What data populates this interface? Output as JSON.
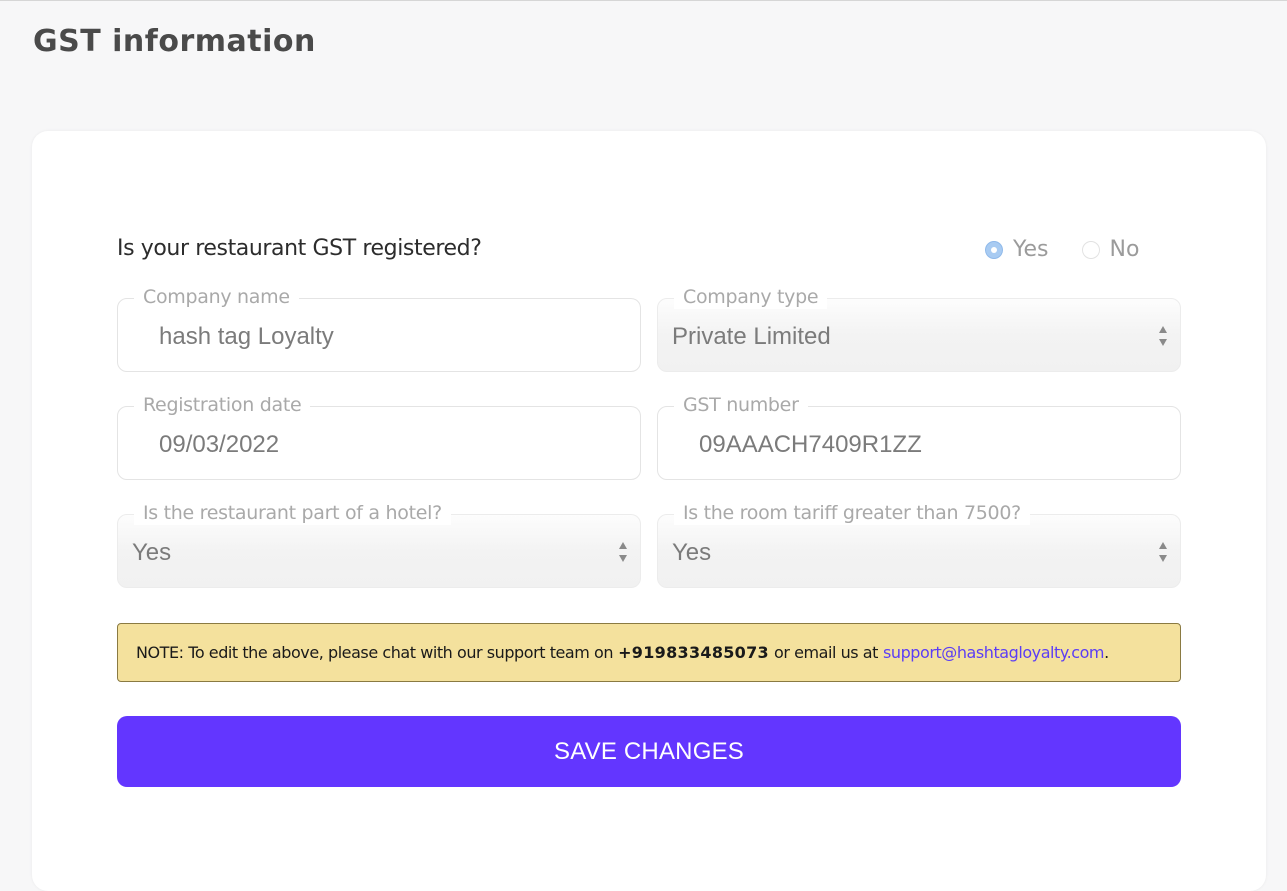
{
  "page": {
    "title": "GST information"
  },
  "form": {
    "question": "Is your restaurant GST registered?",
    "radio": {
      "yes_label": "Yes",
      "no_label": "No",
      "selected": "Yes"
    },
    "fields": {
      "company_name": {
        "label": "Company name",
        "value": "hash tag Loyalty"
      },
      "company_type": {
        "label": "Company type",
        "value": "Private Limited"
      },
      "registration_date": {
        "label": "Registration date",
        "value": "09/03/2022"
      },
      "gst_number": {
        "label": "GST number",
        "value": "09AAACH7409R1ZZ"
      },
      "part_of_hotel": {
        "label": "Is the restaurant part of a hotel?",
        "value": "Yes"
      },
      "room_tariff": {
        "label": "Is the room tariff greater than 7500?",
        "value": "Yes"
      }
    }
  },
  "note": {
    "text_before": "NOTE: To edit the above, please chat with our support team on",
    "phone": "+919833485073",
    "text_middle": "or email us at",
    "email": "support@hashtagloyalty.com",
    "text_after": "."
  },
  "actions": {
    "save_label": "SAVE CHANGES"
  },
  "colors": {
    "accent": "#6336ff",
    "note_background": "#f4e19d",
    "link": "#5b3df5",
    "radio_selected": "#a8cbf2"
  },
  "icons": {
    "select_arrows": "updown-arrows-icon"
  }
}
